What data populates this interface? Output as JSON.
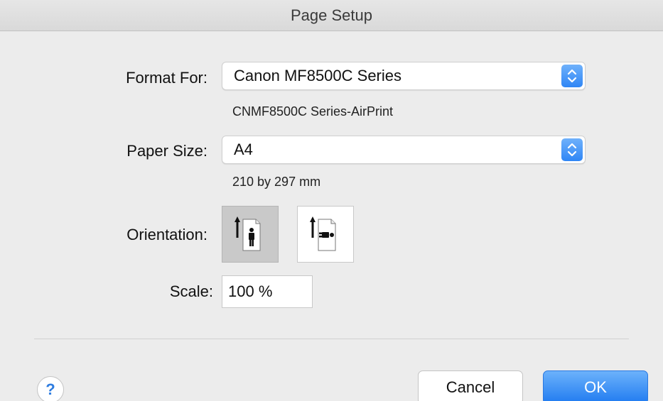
{
  "window": {
    "title": "Page Setup"
  },
  "format_for": {
    "label": "Format For:",
    "value": "Canon MF8500C Series",
    "subtitle": "CNMF8500C Series-AirPrint",
    "stepper_icon": "up-down-chevron-icon"
  },
  "paper_size": {
    "label": "Paper Size:",
    "value": "A4",
    "dimensions": "210 by 297 mm",
    "stepper_icon": "up-down-chevron-icon"
  },
  "orientation": {
    "label": "Orientation:",
    "options": [
      {
        "icon": "portrait-orientation-icon",
        "selected": true
      },
      {
        "icon": "landscape-orientation-icon",
        "selected": false
      }
    ]
  },
  "scale": {
    "label": "Scale:",
    "value": "100 %"
  },
  "footer": {
    "help_label": "?",
    "cancel_label": "Cancel",
    "ok_label": "OK"
  },
  "colors": {
    "accent": "#2f86f5",
    "background": "#ececec"
  }
}
